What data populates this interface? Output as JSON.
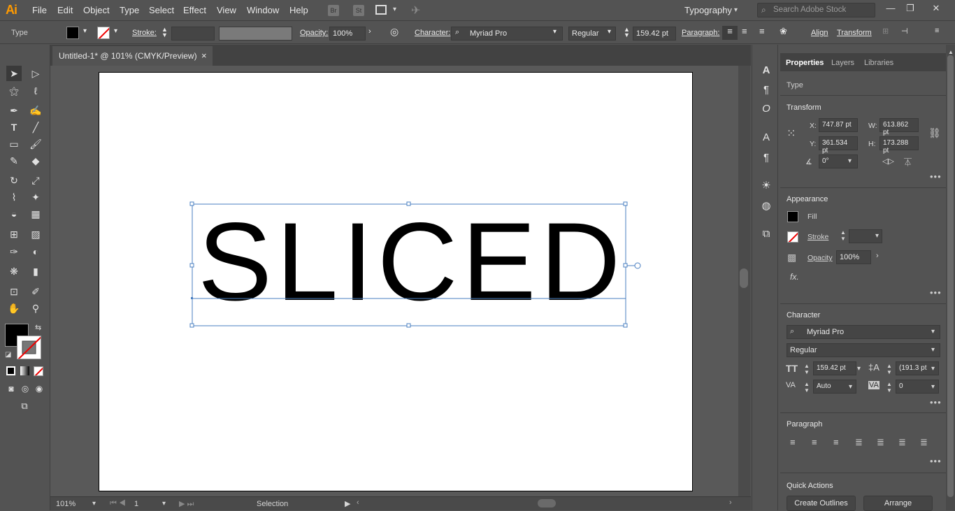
{
  "app": {
    "logo": "Ai"
  },
  "menu": [
    "File",
    "Edit",
    "Object",
    "Type",
    "Select",
    "Effect",
    "View",
    "Window",
    "Help"
  ],
  "app_icons": {
    "bridge": "Br",
    "stock": "St"
  },
  "workspace": "Typography",
  "search_placeholder": "Search Adobe Stock",
  "control": {
    "type_label": "Type",
    "stroke_label": "Stroke:",
    "opacity_label": "Opacity:",
    "opacity_value": "100%",
    "character_label": "Character:",
    "font": "Myriad Pro",
    "style": "Regular",
    "size": "159.42 pt",
    "paragraph_label": "Paragraph:",
    "align_label": "Align",
    "transform_label": "Transform"
  },
  "document": {
    "tab_title": "Untitled-1* @ 101% (CMYK/Preview)",
    "close": "×",
    "text": "SLICED"
  },
  "status": {
    "zoom": "101%",
    "artboard": "1",
    "tool": "Selection"
  },
  "panel": {
    "tabs": [
      "Properties",
      "Layers",
      "Libraries"
    ],
    "selection_type": "Type",
    "transform": {
      "title": "Transform",
      "x_label": "X:",
      "x": "747.87 pt",
      "y_label": "Y:",
      "y": "361.534 pt",
      "w_label": "W:",
      "w": "613.862 pt",
      "h_label": "H:",
      "h": "173.288 pt",
      "angle": "0°"
    },
    "appearance": {
      "title": "Appearance",
      "fill": "Fill",
      "stroke": "Stroke",
      "opacity_label": "Opacity",
      "opacity": "100%",
      "fx": "fx."
    },
    "character": {
      "title": "Character",
      "font": "Myriad Pro",
      "style": "Regular",
      "size": "159.42 pt",
      "leading": "(191.3 pt",
      "kerning": "Auto",
      "tracking": "0"
    },
    "paragraph": {
      "title": "Paragraph"
    },
    "quick_actions": {
      "title": "Quick Actions",
      "create_outlines": "Create Outlines",
      "arrange": "Arrange"
    }
  },
  "colors": {
    "ui_bg": "#535353",
    "accent": "#ff9a00",
    "selection": "#4a7fc1"
  }
}
